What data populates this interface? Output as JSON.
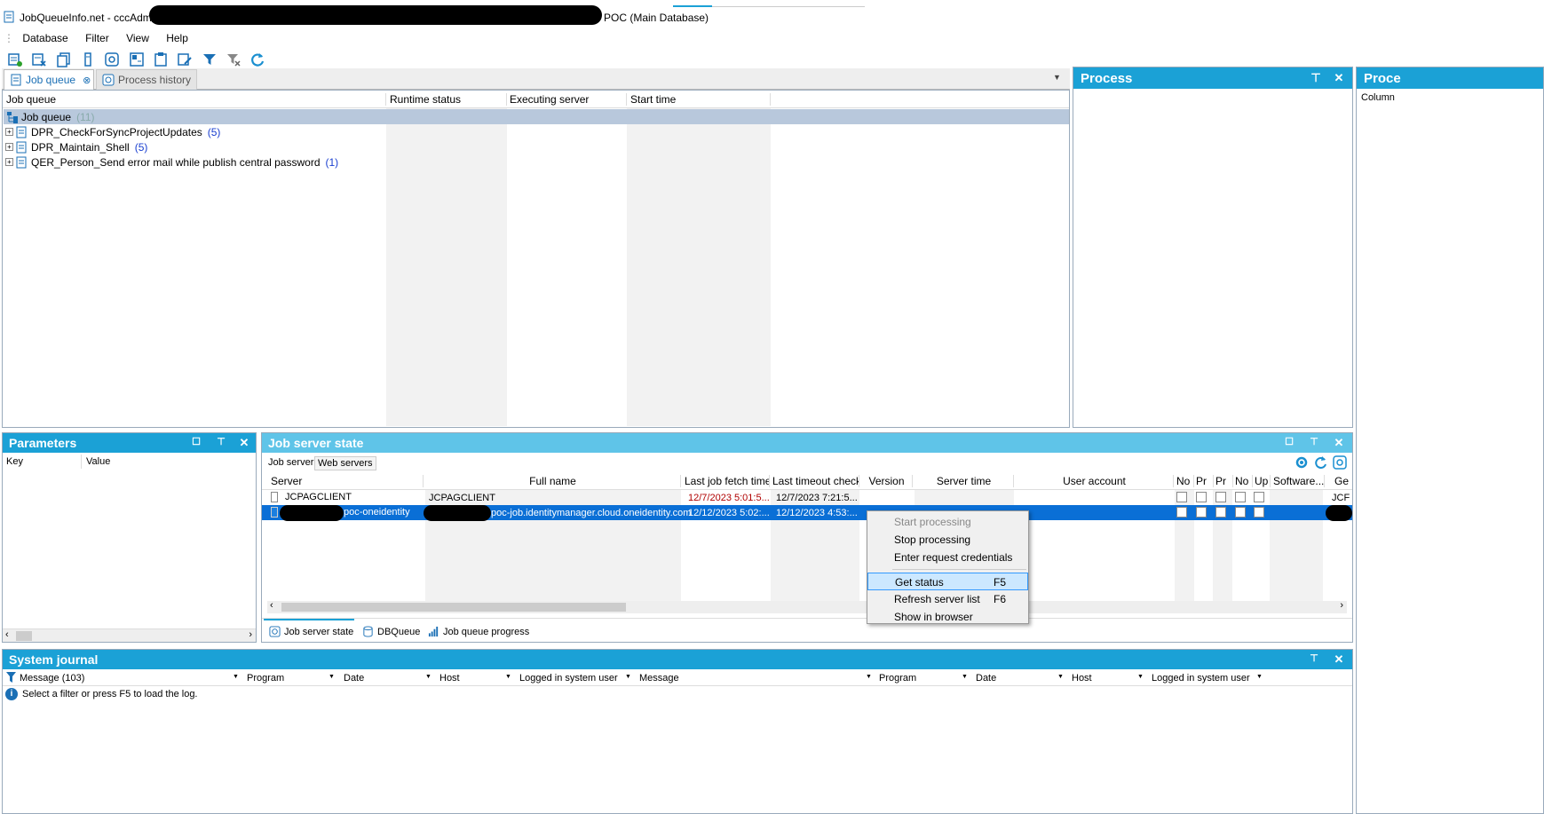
{
  "window": {
    "title_prefix": "JobQueueInfo.net - cccAdmin@",
    "title_suffix": "POC (Main Database)"
  },
  "menu": [
    "Database",
    "Filter",
    "View",
    "Help"
  ],
  "tabs": {
    "job_queue": "Job queue",
    "process_history": "Process history"
  },
  "job_queue": {
    "columns": [
      "Job queue",
      "Runtime status",
      "Executing server",
      "Start time"
    ],
    "root": {
      "label": "Job queue",
      "count": "(11)"
    },
    "items": [
      {
        "label": "DPR_CheckForSyncProjectUpdates",
        "count": "(5)"
      },
      {
        "label": "DPR_Maintain_Shell",
        "count": "(5)"
      },
      {
        "label": "QER_Person_Send error mail while publish central password",
        "count": "(1)"
      }
    ]
  },
  "process_panel": {
    "title": "Process"
  },
  "process2_panel": {
    "title": "Proce",
    "column": "Column"
  },
  "parameters": {
    "title": "Parameters",
    "columns": [
      "Key",
      "Value"
    ]
  },
  "job_server_state": {
    "title": "Job server state",
    "subtabs": [
      "Job server",
      "Web servers"
    ],
    "columns": [
      "Server",
      "Full name",
      "Last job fetch time",
      "Last timeout check",
      "Version",
      "Server time",
      "User account",
      "No",
      "Pr",
      "Pr",
      "No",
      "Up",
      "Software...",
      "Ge"
    ],
    "rows": [
      {
        "server": "JCPAGCLIENT",
        "full_name": "JCPAGCLIENT",
        "last_fetch": "12/7/2023 5:01:5...",
        "last_timeout": "12/7/2023 7:21:5...",
        "account": "JCF"
      },
      {
        "server": "poc-oneidentity",
        "full_name": "poc-job.identitymanager.cloud.oneidentity.com",
        "last_fetch": "12/12/2023 5:02:...",
        "last_timeout": "12/12/2023 4:53:..."
      }
    ],
    "bottom_tabs": [
      "Job server state",
      "DBQueue",
      "Job queue progress"
    ]
  },
  "context_menu": {
    "items": [
      {
        "label": "Start processing",
        "shortcut": "",
        "disabled": true
      },
      {
        "label": "Stop processing",
        "shortcut": ""
      },
      {
        "label": "Enter request credentials",
        "shortcut": ""
      },
      {
        "label": "Get status",
        "shortcut": "F5",
        "highlighted": true
      },
      {
        "label": "Refresh server list",
        "shortcut": "F6"
      },
      {
        "label": "Show in browser",
        "shortcut": ""
      }
    ]
  },
  "system_journal": {
    "title": "System journal",
    "filter_label": "Message (103)",
    "columns": [
      "Program",
      "Date",
      "Host",
      "Logged in system user",
      "Message",
      "Program",
      "Date",
      "Host",
      "Logged in system user"
    ],
    "hint": "Select a filter or press F5 to load the log."
  },
  "colors": {
    "accent": "#1ba1d6",
    "accent_light": "#5fc4e8",
    "selection": "#0a6fd6",
    "tree_selection": "#b8c8dc"
  }
}
